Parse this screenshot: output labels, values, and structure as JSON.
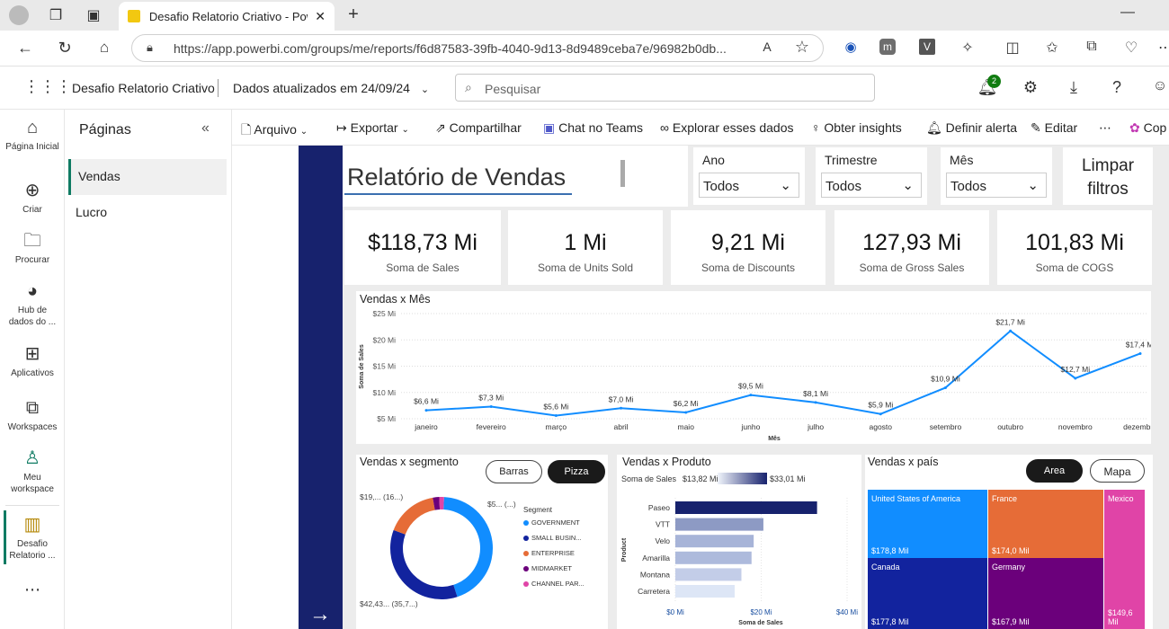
{
  "browser": {
    "tab_title": "Desafio Relatorio Criativo - Power",
    "url": "https://app.powerbi.com/groups/me/reports/f6d87583-39fb-4040-9d13-8d9489ceba7e/96982b0db..."
  },
  "header": {
    "report_name": "Desafio Relatorio Criativo",
    "updated": "Dados atualizados em 24/09/24",
    "search_placeholder": "Pesquisar",
    "notif_count": "2"
  },
  "leftnav": [
    {
      "label": "Página Inicial",
      "icon": "home-icon"
    },
    {
      "label": "Criar",
      "icon": "create-icon"
    },
    {
      "label": "Procurar",
      "icon": "folder-icon"
    },
    {
      "label": "Hub de dados do ...",
      "icon": "data-hub-icon"
    },
    {
      "label": "Aplicativos",
      "icon": "apps-icon"
    },
    {
      "label": "Workspaces",
      "icon": "workspaces-icon"
    },
    {
      "label": "Meu workspace",
      "icon": "my-workspace-icon"
    },
    {
      "label": "Desafio Relatorio ...",
      "icon": "report-icon"
    }
  ],
  "pages": {
    "title": "Páginas",
    "items": [
      "Vendas",
      "Lucro"
    ],
    "active": 0
  },
  "toolbar": {
    "arquivo": "Arquivo",
    "exportar": "Exportar",
    "compartilhar": "Compartilhar",
    "teams": "Chat no Teams",
    "explorar": "Explorar esses dados",
    "insights": "Obter insights",
    "alerta": "Definir alerta",
    "editar": "Editar",
    "copilot": "Cop"
  },
  "report": {
    "title": "Relatório de Vendas",
    "slicers": [
      {
        "label": "Ano",
        "value": "Todos"
      },
      {
        "label": "Trimestre",
        "value": "Todos"
      },
      {
        "label": "Mês",
        "value": "Todos"
      }
    ],
    "clear_filters": "Limpar filtros",
    "kpis": [
      {
        "value": "$118,73 Mi",
        "label": "Soma de  Sales"
      },
      {
        "value": "1 Mi",
        "label": "Soma de Units Sold"
      },
      {
        "value": "9,21 Mi",
        "label": "Soma de Discounts"
      },
      {
        "value": "127,93 Mi",
        "label": "Soma de Gross Sales"
      },
      {
        "value": "101,83 Mi",
        "label": "Soma de COGS"
      }
    ]
  },
  "chart_data": [
    {
      "type": "line",
      "title": "Vendas x Mês",
      "xlabel": "Mês",
      "ylabel": "Soma de Sales",
      "yticks": [
        "$5 Mi",
        "$10 Mi",
        "$15 Mi",
        "$20 Mi",
        "$25 Mi"
      ],
      "ylim": [
        5,
        25
      ],
      "categories": [
        "janeiro",
        "fevereiro",
        "março",
        "abril",
        "maio",
        "junho",
        "julho",
        "agosto",
        "setembro",
        "outubro",
        "novembro",
        "dezembro"
      ],
      "values": [
        6.6,
        7.3,
        5.6,
        7.0,
        6.2,
        9.5,
        8.1,
        5.9,
        10.9,
        21.7,
        12.7,
        17.4
      ],
      "labels": [
        "$6,6 Mi",
        "$7,3 Mi",
        "$5,6 Mi",
        "$7,0 Mi",
        "$6,2 Mi",
        "$9,5 Mi",
        "$8,1 Mi",
        "$5,9 Mi",
        "$10,9 Mi",
        "$21,7 Mi",
        "$12,7 Mi",
        "$17,4 Mi"
      ],
      "color": "#118dff"
    },
    {
      "type": "pie",
      "title": "Vendas x segmento",
      "buttons": [
        "Barras",
        "Pizza"
      ],
      "legend_title": "Segment",
      "segments": [
        {
          "name": "GOVERNMENT",
          "value": 52.5,
          "label": "$5... (...)",
          "color": "#118dff"
        },
        {
          "name": "SMALL BUSIN...",
          "value": 42.43,
          "label": "$42,43... (35,7...)",
          "color": "#12239e"
        },
        {
          "name": "ENTERPRISE",
          "value": 19.6,
          "label": "$19,... (16...)",
          "color": "#e66c37"
        },
        {
          "name": "MIDMARKET",
          "value": 2.4,
          "label": "",
          "color": "#6b007b"
        },
        {
          "name": "CHANNEL PAR...",
          "value": 1.8,
          "label": "",
          "color": "#e044a7"
        }
      ]
    },
    {
      "type": "bar",
      "title": "Vendas x Produto",
      "color_scale_label": "Soma de Sales",
      "color_min": "$13,82 Mi",
      "color_max": "$33,01 Mi",
      "ylabel": "Product",
      "xlabel": "Soma de Sales",
      "xticks": [
        "$0 Mi",
        "$20 Mi",
        "$40 Mi"
      ],
      "xlim": [
        0,
        40
      ],
      "categories": [
        "Paseo",
        "VTT",
        "Velo",
        "Amarilla",
        "Montana",
        "Carretera"
      ],
      "values": [
        33.01,
        20.51,
        18.25,
        17.75,
        15.39,
        13.82
      ],
      "colors": [
        "#17226d",
        "#8d9ac4",
        "#a7b4d8",
        "#adbadc",
        "#c3cde8",
        "#dde6f6"
      ]
    },
    {
      "type": "treemap",
      "title": "Vendas x país",
      "buttons": [
        "Area",
        "Mapa"
      ],
      "items": [
        {
          "name": "United States of America",
          "value": "$178,8 Mil",
          "color": "#118dff"
        },
        {
          "name": "France",
          "value": "$174,0 Mil",
          "color": "#e66c37"
        },
        {
          "name": "Mexico",
          "value": "$149,6 Mil",
          "color": "#e044a7"
        },
        {
          "name": "Canada",
          "value": "$177,8 Mil",
          "color": "#12239e"
        },
        {
          "name": "Germany",
          "value": "$167,9 Mil",
          "color": "#6b007b"
        }
      ]
    }
  ]
}
